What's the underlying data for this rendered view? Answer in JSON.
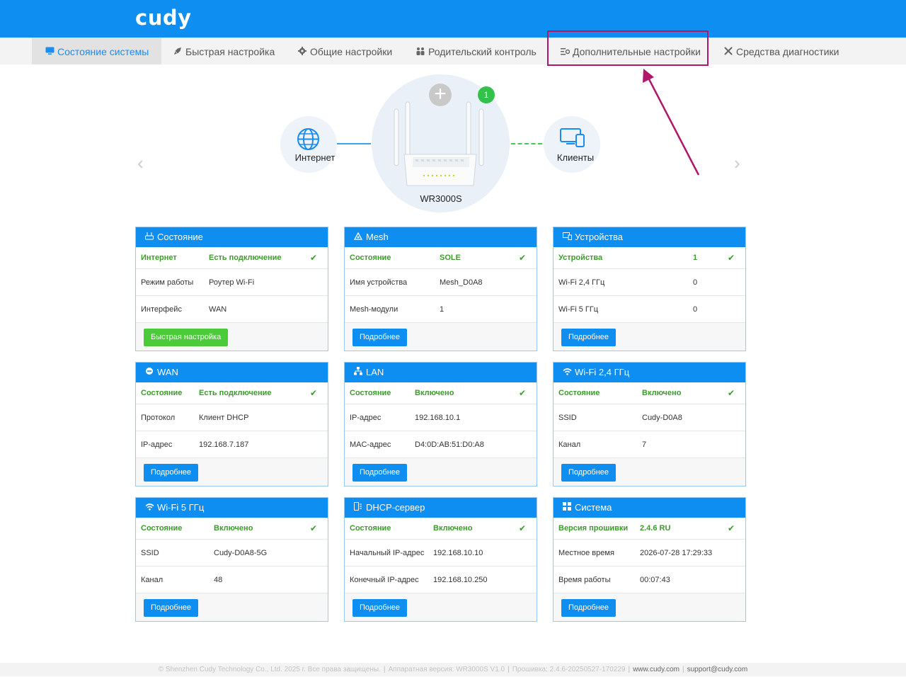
{
  "brand": {
    "logo": "cudy",
    "accent": "#0f8ef2",
    "success": "#3c9b2c",
    "annotation": "#b0166a"
  },
  "nav": {
    "items": [
      {
        "label": "Состояние системы",
        "icon": "monitor-icon",
        "active": true
      },
      {
        "label": "Быстрая настройка",
        "icon": "rocket-icon"
      },
      {
        "label": "Общие настройки",
        "icon": "gear-icon"
      },
      {
        "label": "Родительский контроль",
        "icon": "family-icon"
      },
      {
        "label": "Дополнительные настройки",
        "icon": "advanced-settings-icon",
        "highlighted": true
      },
      {
        "label": "Средства диагностики",
        "icon": "tools-icon"
      }
    ]
  },
  "topology": {
    "internet_label": "Интернет",
    "router_label": "WR3000S",
    "clients_label": "Клиенты",
    "clients_badge": "1",
    "add_glyph": "+"
  },
  "cards": [
    {
      "title": "Состояние",
      "icon": "router-icon",
      "rows": [
        [
          "Интернет",
          "Есть подключение"
        ],
        [
          "Режим работы",
          "Роутер Wi-Fi"
        ],
        [
          "Интерфейс",
          "WAN"
        ]
      ],
      "button": "Быстрая настройка"
    },
    {
      "title": "Mesh",
      "icon": "mesh-icon",
      "rows": [
        [
          "Состояние",
          "SOLE"
        ],
        [
          "Имя устройства",
          "Mesh_D0A8"
        ],
        [
          "Mesh-модули",
          "1"
        ]
      ],
      "button": "Подробнее"
    },
    {
      "title": "Устройства",
      "icon": "devices-icon",
      "rows": [
        [
          "Устройства",
          "1"
        ],
        [
          "Wi-Fi 2,4 ГГц",
          "0"
        ],
        [
          "Wi-Fi 5 ГГц",
          "0"
        ]
      ],
      "button": "Подробнее"
    },
    {
      "title": "WAN",
      "icon": "ie-icon",
      "rows": [
        [
          "Состояние",
          "Есть подключение"
        ],
        [
          "Протокол",
          "Клиент DHCP"
        ],
        [
          "IP-адрес",
          "192.168.7.187"
        ]
      ],
      "button": "Подробнее"
    },
    {
      "title": "LAN",
      "icon": "lan-icon",
      "rows": [
        [
          "Состояние",
          "Включено"
        ],
        [
          "IP-адрес",
          "192.168.10.1"
        ],
        [
          "MAC-адрес",
          "D4:0D:AB:51:D0:A8"
        ]
      ],
      "button": "Подробнее"
    },
    {
      "title": "Wi-Fi 2,4 ГГц",
      "icon": "wifi-icon",
      "rows": [
        [
          "Состояние",
          "Включено"
        ],
        [
          "SSID",
          "Cudy-D0A8"
        ],
        [
          "Канал",
          "7"
        ]
      ],
      "button": "Подробнее"
    },
    {
      "title": "Wi-Fi 5 ГГц",
      "icon": "wifi-icon",
      "rows": [
        [
          "Состояние",
          "Включено"
        ],
        [
          "SSID",
          "Cudy-D0A8-5G"
        ],
        [
          "Канал",
          "48"
        ]
      ],
      "button": "Подробнее"
    },
    {
      "title": "DHCP-сервер",
      "icon": "dhcp-icon",
      "rows": [
        [
          "Состояние",
          "Включено"
        ],
        [
          "Начальный IP-адрес",
          "192.168.10.10"
        ],
        [
          "Конечный IP-адрес",
          "192.168.10.250"
        ]
      ],
      "button": "Подробнее"
    },
    {
      "title": "Система",
      "icon": "system-icon",
      "rows": [
        [
          "Версия прошивки",
          "2.4.6 RU"
        ],
        [
          "Местное время",
          "2026-07-28 17:29:33"
        ],
        [
          "Время работы",
          "00:07:43"
        ]
      ],
      "button": "Подробнее"
    }
  ],
  "footer": {
    "copyright": "© Shenzhen Cudy Technology Co., Ltd. 2025 г. Все права защищены.",
    "hardware": "Аппаратная версия: WR3000S V1.0",
    "firmware": "Прошивка: 2.4.6-20250527-170229",
    "site": "www.cudy.com",
    "email": "support@cudy.com"
  }
}
